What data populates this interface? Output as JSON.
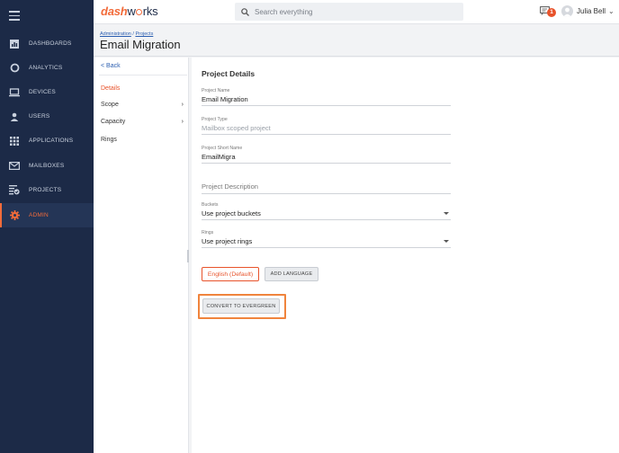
{
  "app": {
    "logo_part1": "dash",
    "logo_part2": "w",
    "logo_part3": "rks"
  },
  "search": {
    "placeholder": "Search everything"
  },
  "notifications": {
    "count": "1"
  },
  "user": {
    "name": "Julia Bell"
  },
  "sidebar": {
    "items": [
      {
        "label": "DASHBOARDS",
        "icon": "bar-chart-icon"
      },
      {
        "label": "ANALYTICS",
        "icon": "donut-chart-icon"
      },
      {
        "label": "DEVICES",
        "icon": "laptop-icon"
      },
      {
        "label": "USERS",
        "icon": "person-icon"
      },
      {
        "label": "APPLICATIONS",
        "icon": "grid-icon"
      },
      {
        "label": "MAILBOXES",
        "icon": "mail-icon"
      },
      {
        "label": "PROJECTS",
        "icon": "projects-icon"
      },
      {
        "label": "ADMIN",
        "icon": "gear-icon",
        "active": true
      }
    ]
  },
  "breadcrumb": {
    "items": [
      "Administration",
      "Projects"
    ],
    "separator": "/"
  },
  "page": {
    "title": "Email Migration"
  },
  "subnav": {
    "back_label": "< Back",
    "items": [
      {
        "label": "Details",
        "active": true
      },
      {
        "label": "Scope",
        "has_chevron": true
      },
      {
        "label": "Capacity",
        "has_chevron": true
      },
      {
        "label": "Rings"
      }
    ]
  },
  "details": {
    "section_title": "Project Details",
    "project_name": {
      "label": "Project Name",
      "value": "Email Migration"
    },
    "project_type": {
      "label": "Project Type",
      "value": "Mailbox scoped project"
    },
    "short_name": {
      "label": "Project Short Name",
      "value": "EmailMigra"
    },
    "description": {
      "placeholder": "Project Description"
    },
    "buckets": {
      "label": "Buckets",
      "value": "Use project buckets"
    },
    "rings": {
      "label": "Rings",
      "value": "Use project rings"
    },
    "language_button": "English (Default)",
    "add_language_button": "ADD LANGUAGE",
    "convert_button": "CONVERT TO EVERGREEN"
  },
  "colors": {
    "sidebar_bg": "#1c2a47",
    "accent": "#e8532b",
    "highlight": "#f0843d",
    "link": "#2a5db0"
  }
}
